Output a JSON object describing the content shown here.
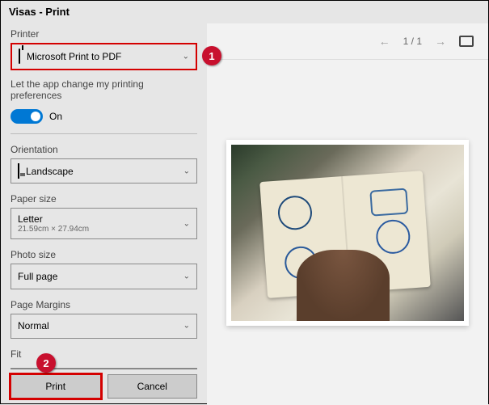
{
  "window": {
    "title": "Visas - Print"
  },
  "callouts": {
    "one": "1",
    "two": "2"
  },
  "printer": {
    "label": "Printer",
    "selected": "Microsoft Print to PDF"
  },
  "pref": {
    "label": "Let the app change my printing preferences",
    "state": "On"
  },
  "orientation": {
    "label": "Orientation",
    "selected": "Landscape"
  },
  "paper": {
    "label": "Paper size",
    "selected": "Letter",
    "dims": "21.59cm × 27.94cm"
  },
  "photo": {
    "label": "Photo size",
    "selected": "Full page"
  },
  "margins": {
    "label": "Page Margins",
    "selected": "Normal"
  },
  "fit": {
    "label": "Fit"
  },
  "buttons": {
    "print": "Print",
    "cancel": "Cancel"
  },
  "preview": {
    "page_indicator": "1 / 1"
  }
}
